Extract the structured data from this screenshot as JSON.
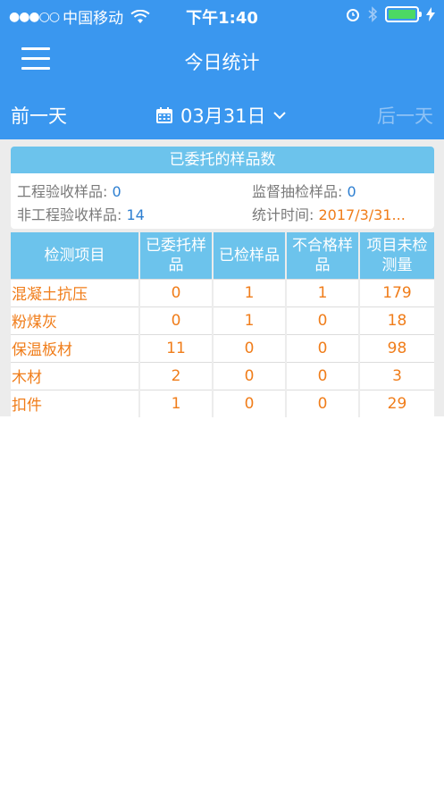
{
  "status_bar": {
    "signal": "●●●○○",
    "carrier": "中国移动",
    "time": "下午1:40"
  },
  "nav": {
    "title": "今日统计"
  },
  "date_bar": {
    "prev_label": "前一天",
    "date_label": "03月31日",
    "dropdown_glyph": "⌄",
    "next_label": "后一天"
  },
  "summary": {
    "title": "已委托的样品数",
    "engineering_label": "工程验收样品:",
    "engineering_value": "0",
    "supervision_label": "监督抽检样品:",
    "supervision_value": "0",
    "non_engineering_label": "非工程验收样品:",
    "non_engineering_value": "14",
    "stat_time_label": "统计时间:",
    "stat_time_value": "2017/3/31..."
  },
  "table": {
    "headers": [
      "检测项目",
      "已委托样品",
      "已检样品",
      "不合格样品",
      "项目未检测量"
    ],
    "rows": [
      {
        "name": "混凝土抗压",
        "entrusted": "0",
        "tested": "1",
        "unqualified": "1",
        "untested": "179"
      },
      {
        "name": "粉煤灰",
        "entrusted": "0",
        "tested": "1",
        "unqualified": "0",
        "untested": "18"
      },
      {
        "name": "保温板材",
        "entrusted": "11",
        "tested": "0",
        "unqualified": "0",
        "untested": "98"
      },
      {
        "name": "木材",
        "entrusted": "2",
        "tested": "0",
        "unqualified": "0",
        "untested": "3"
      },
      {
        "name": "扣件",
        "entrusted": "1",
        "tested": "0",
        "unqualified": "0",
        "untested": "29"
      }
    ]
  },
  "colors": {
    "header_blue": "#3a97ef",
    "table_header": "#6cc3ec",
    "value_orange": "#f07d1a",
    "value_blue": "#2d7fd1"
  }
}
